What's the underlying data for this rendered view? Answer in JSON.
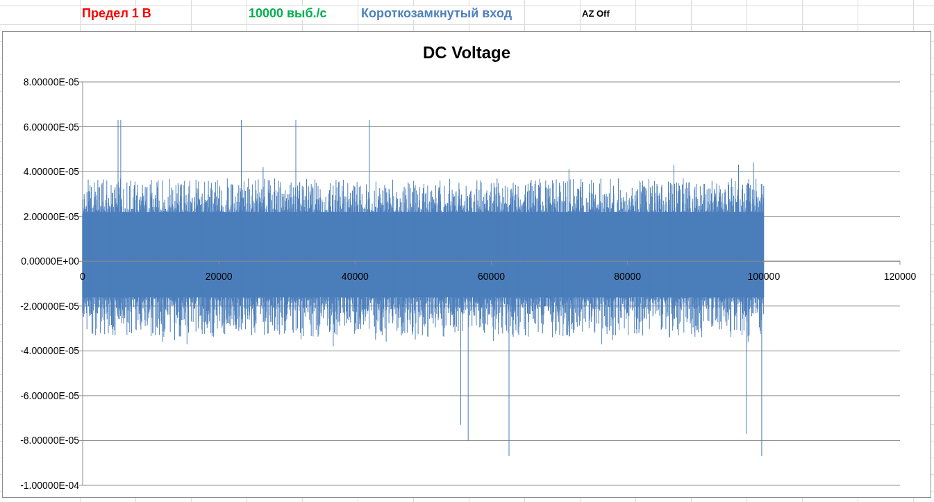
{
  "sheet_row": [
    {
      "text": "Предел 1 В",
      "color": "#ff0000",
      "kind": "heading"
    },
    {
      "text": "10000 выб./с",
      "color": "#00b050",
      "kind": "heading"
    },
    {
      "text": "Короткозамкнутый вход",
      "color": "#4f81bd",
      "kind": "heading"
    },
    {
      "text": "AZ Off",
      "color": "#000000",
      "kind": "note"
    }
  ],
  "chart": {
    "title": "DC Voltage",
    "y_axis_labels": [
      "8.00000E-05",
      "6.00000E-05",
      "4.00000E-05",
      "2.00000E-05",
      "0.00000E+00",
      "-2.00000E-05",
      "-4.00000E-05",
      "-6.00000E-05",
      "-8.00000E-05",
      "-1.00000E-04"
    ],
    "x_axis_labels": [
      "0",
      "20000",
      "40000",
      "60000",
      "80000",
      "100000",
      "120000"
    ]
  }
}
